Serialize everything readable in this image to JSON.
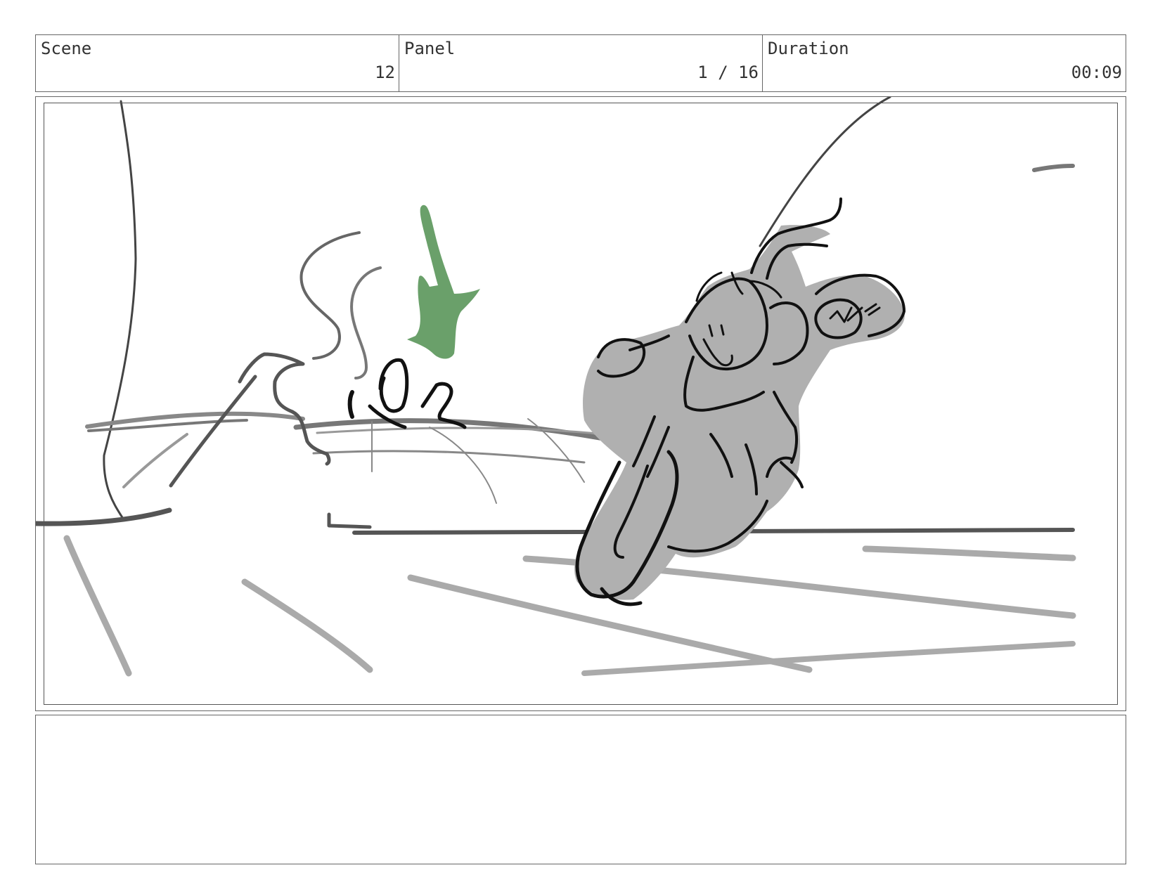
{
  "header": {
    "scene": {
      "label": "Scene",
      "value": "12"
    },
    "panel": {
      "label": "Panel",
      "value": "1 / 16"
    },
    "duration": {
      "label": "Duration",
      "value": "00:09"
    }
  },
  "sketch": {
    "colors": {
      "line_dark": "#111111",
      "line_mid": "#555555",
      "line_light": "#a8a8a8",
      "fill_gray": "#b0b0b0",
      "accent_green": "#6aa06a"
    },
    "subjects": [
      "scooter-rider",
      "green-figure",
      "curved-road",
      "roadside-wall"
    ]
  },
  "notes": {
    "text": ""
  }
}
